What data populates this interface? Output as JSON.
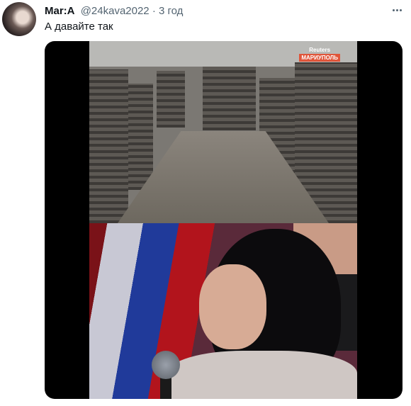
{
  "tweet": {
    "author_name": "Mar:A",
    "handle": "@24kava2022",
    "separator": "·",
    "time": "3 год",
    "text": "А давайте так"
  },
  "media": {
    "watermark_brand": "Reuters",
    "watermark_place": "МАРИУПОЛЬ"
  },
  "colors": {
    "text_primary": "#0f1419",
    "text_secondary": "#536471",
    "watermark_bg": "#e0553a"
  },
  "icons": {
    "more": "more-horizontal-icon"
  }
}
